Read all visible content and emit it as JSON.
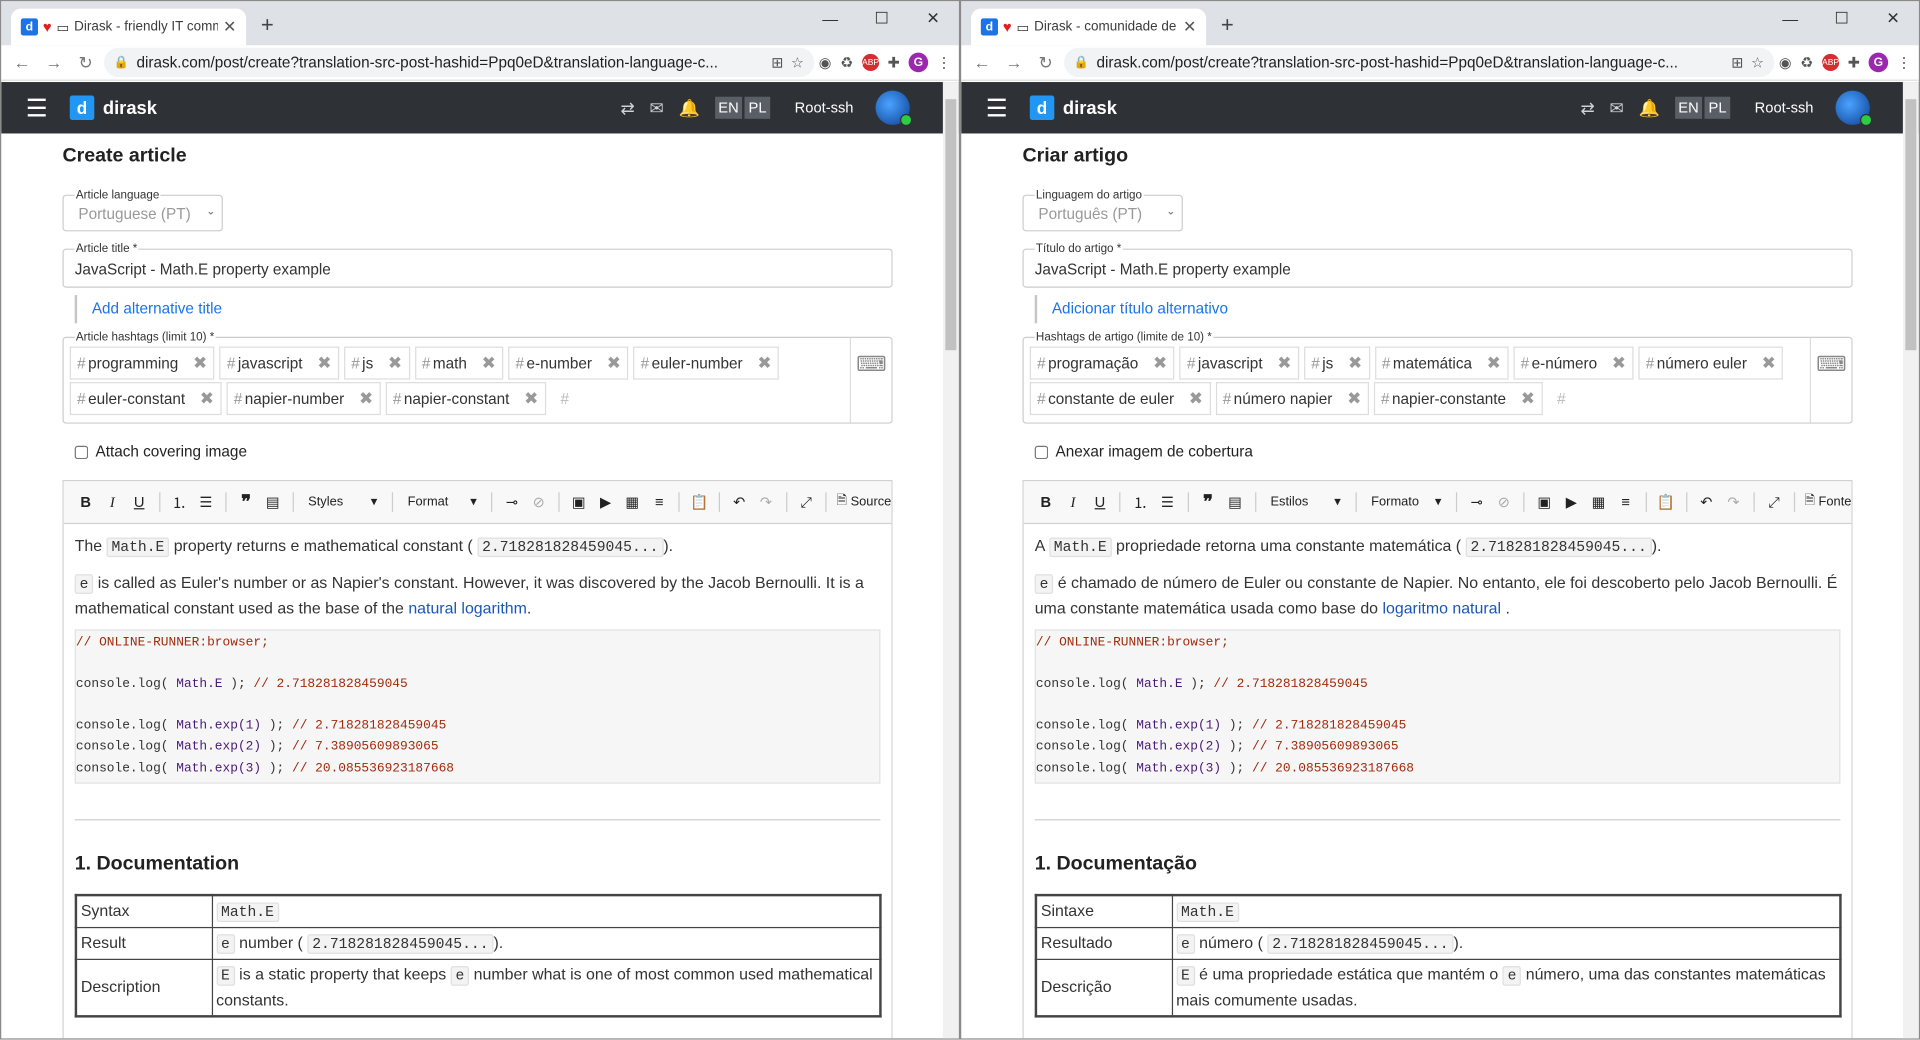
{
  "windows": [
    {
      "tab_title": "Dirask - friendly IT comm",
      "url": "dirask.com/post/create?translation-src-post-hashid=Ppq0eD&translation-language-c...",
      "app": {
        "logo": "d",
        "name": "dirask",
        "lang_en": "EN",
        "lang_pl": "PL",
        "username": "Root-ssh"
      },
      "page_title": "Create article",
      "language_label": "Article language",
      "language_value": "Portuguese (PT)",
      "title_label": "Article title *",
      "title_value": "JavaScript - Math.E property example",
      "alt_title_link": "Add alternative title",
      "hashtags_label": "Article hashtags (limit 10) *",
      "hashtags": [
        "programming",
        "javascript",
        "js",
        "math",
        "e-number",
        "euler-number",
        "euler-constant",
        "napier-number",
        "napier-constant"
      ],
      "attach_label": "Attach covering image",
      "styles_label": "Styles",
      "format_label": "Format",
      "source_label": "Source",
      "p1_a": "The ",
      "p1_code": "Math.E",
      "p1_b": " property returns e mathematical constant (",
      "p1_const": "2.718281828459045...",
      "p1_c": ").",
      "p2_code": "e",
      "p2_a": " is called as Euler's number or as Napier's constant. However, it was discovered by the Jacob Bernoulli. It is a mathematical constant used as the base of the ",
      "p2_link": "natural logarithm",
      "p2_b": ".",
      "code": {
        "c1": "// ONLINE-RUNNER:browser;",
        "l2a": "console.log( ",
        "l2b": "Math.E",
        "l2c": " ); ",
        "l2d": "// 2.718281828459045",
        "l3a": "console.log( ",
        "l3b": "Math.exp(1)",
        "l3c": " ); ",
        "l3d": "// 2.718281828459045",
        "l4a": "console.log( ",
        "l4b": "Math.exp(2)",
        "l4c": " ); ",
        "l4d": "// 7.38905609893065",
        "l5a": "console.log( ",
        "l5b": "Math.exp(3)",
        "l5c": " ); ",
        "l5d": "// 20.085536923187668"
      },
      "doc_heading": "1. Documentation",
      "table": {
        "k1": "Syntax",
        "v1": "Math.E",
        "k2": "Result",
        "v2_code": "e",
        "v2_a": " number (",
        "v2_const": "2.718281828459045...",
        "v2_b": ").",
        "k3": "Description",
        "v3_code1": "E",
        "v3_a": " is a static property that keeps ",
        "v3_code2": "e",
        "v3_b": " number what is one of most common used mathematical constants."
      }
    },
    {
      "tab_title": "Dirask - comunidade de T",
      "url": "dirask.com/post/create?translation-src-post-hashid=Ppq0eD&translation-language-c...",
      "app": {
        "logo": "d",
        "name": "dirask",
        "lang_en": "EN",
        "lang_pl": "PL",
        "username": "Root-ssh"
      },
      "page_title": "Criar artigo",
      "language_label": "Linguagem do artigo",
      "language_value": "Português (PT)",
      "title_label": "Título do artigo *",
      "title_value": "JavaScript - Math.E property example",
      "alt_title_link": "Adicionar título alternativo",
      "hashtags_label": "Hashtags de artigo (limite de 10) *",
      "hashtags": [
        "programação",
        "javascript",
        "js",
        "matemática",
        "e-número",
        "número euler",
        "constante de euler",
        "número napier",
        "napier-constante"
      ],
      "attach_label": "Anexar imagem de cobertura",
      "styles_label": "Estilos",
      "format_label": "Formato",
      "source_label": "Fonte",
      "p1_a": "A ",
      "p1_code": "Math.E",
      "p1_b": " propriedade retorna uma constante matemática (",
      "p1_const": "2.718281828459045...",
      "p1_c": ").",
      "p2_code": "e",
      "p2_a": " é chamado de número de Euler ou constante de Napier. No entanto, ele foi descoberto pelo Jacob Bernoulli. É uma constante matemática usada como base do ",
      "p2_link": "logaritmo natural",
      "p2_b": " .",
      "code": {
        "c1": "// ONLINE-RUNNER:browser;",
        "l2a": "console.log( ",
        "l2b": "Math.E",
        "l2c": " ); ",
        "l2d": "// 2.718281828459045",
        "l3a": "console.log( ",
        "l3b": "Math.exp(1)",
        "l3c": " ); ",
        "l3d": "// 2.718281828459045",
        "l4a": "console.log( ",
        "l4b": "Math.exp(2)",
        "l4c": " ); ",
        "l4d": "// 7.38905609893065",
        "l5a": "console.log( ",
        "l5b": "Math.exp(3)",
        "l5c": " ); ",
        "l5d": "// 20.085536923187668"
      },
      "doc_heading": "1. Documentação",
      "table": {
        "k1": "Sintaxe",
        "v1": "Math.E",
        "k2": "Resultado",
        "v2_code": "e",
        "v2_a": " número (",
        "v2_const": "2.718281828459045...",
        "v2_b": ").",
        "k3": "Descrição",
        "v3_code1": "E",
        "v3_a": " é uma propriedade estática que mantém o ",
        "v3_code2": "e",
        "v3_b": " número, uma das constantes matemáticas mais comumente usadas."
      }
    }
  ]
}
